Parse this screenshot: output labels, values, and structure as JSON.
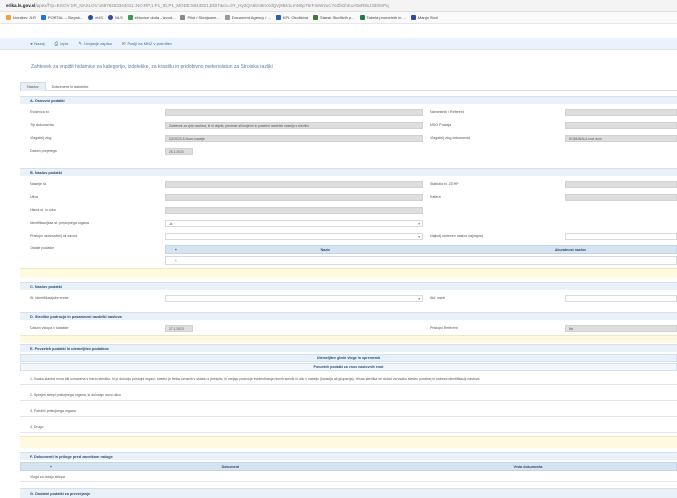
{
  "browser": {
    "url_host": "erika.ls.gov.sl",
    "url_path": "/apex/f?p=EGOV:SR_NASLOV:15879263344011::NO:RP,1:P1_ID,P1_MODE:5843921,EDIT&cs=3Y_Hy2QAtEm8mXdQVj9Bk1LmN0pT6rF4sW2uC7eZbGhKoA5vR8xJ3iD9nPq"
  },
  "bookmarks": [
    {
      "label": "Izvrsitev JLR",
      "color": "#f2a23a"
    },
    {
      "label": "PORTAL – Slepsk...",
      "color": "#1a73e8"
    },
    {
      "label": "eUS",
      "color": "#2a4f9e"
    },
    {
      "label": "NLS",
      "color": "#2a4f9e"
    },
    {
      "label": "eNovice doda - izvod...",
      "color": "#3c9d4a"
    },
    {
      "label": "Pilot / Skrajsane...",
      "color": "#888888"
    },
    {
      "label": "Document Agency / ...",
      "color": "#999999"
    },
    {
      "label": "KPL Okolistna",
      "color": "#2b5fb3"
    },
    {
      "label": "Starsk Storlitvih p...",
      "color": "#3a7d32"
    },
    {
      "label": "Tabela prometnih in ...",
      "color": "#1e7f4a"
    },
    {
      "label": "Manja Stori",
      "color": "#2a4f9e"
    }
  ],
  "toolbar": {
    "buttons": [
      {
        "icon": "◂",
        "label": "Nazaj"
      },
      {
        "icon": "⎙",
        "label": "Izpis"
      },
      {
        "icon": "✎",
        "label": "Urejanje zapisa"
      },
      {
        "icon": "✉",
        "label": "Poslji na MNZ v potrditev"
      }
    ]
  },
  "page": {
    "title": "Zahtevek za vnpiitit hidamice za kategorijo, izdelekke, za krastilu in pridobivno meteriolatun za Stroiska razliki",
    "tabs": [
      "Naslov",
      "Dokument in datoteke"
    ]
  },
  "sections": {
    "osnovni": {
      "header": "A. Osnovni podatki",
      "labels": [
        "Evidenca st.",
        "Tip dokumenta",
        "Vlagatelj vlog",
        "Datum prejetega"
      ],
      "values": [
        "",
        "Zahtevek za vpis naslova, ki ni objekt, predmet ali krajevni in posebni razdelek naselja s stevilko",
        "DZ/2023-5-Novo naselje",
        "25.1.2023"
      ],
      "right_labels": [
        "Namestnik / Referent",
        "MSO Postaja",
        "Vlagatelj vlog dokumenta"
      ],
      "right_values": [
        "",
        "",
        "KOMUNALA novi dom"
      ]
    },
    "naslov": {
      "header": "B. Naslov podatki",
      "labels": [
        "Naselje st.",
        "Ulica",
        "Hisna st. in crka",
        "Identifikacijska st. pristojnega organa",
        "Pristojni ustanovitelj ali zavod"
      ],
      "field_values": [
        "",
        "",
        "",
        "",
        "",
        ""
      ],
      "yes_value": "Ja",
      "other_label": "Ostale podatke",
      "no_value": "Ne",
      "right_labels": [
        "Statistia st. ZGHP",
        "Katera",
        "Najbolj ustrezen naslov najnaprej"
      ],
      "right_values": [
        "",
        "",
        ""
      ],
      "subtable_cols": [
        "Naziv",
        "Akuratnost naslov"
      ]
    },
    "naslov2": {
      "header": "C. Naslov podatki",
      "label": "St. identifikacijske enote",
      "right_label": "Akt. oseb",
      "value": "",
      "right_value": ""
    },
    "stevilke": {
      "header": "D. Stevilke podrocja in posamezni razdelki naslova",
      "label": "Datum vstopa v kataster",
      "value": "27.1.2023",
      "right_label": "Pristojni Referent",
      "right_value": "Ne"
    },
    "povzetek": {
      "header": "E. Povzetek podatki in utemeljitev podatkov",
      "band1": "Utemeljitev glede vloge in sprememb",
      "band2": "Povzetek podatki za vnos naslovnih enot",
      "rows": [
        "1. Vsaka stavba mora biti oznacena s hisno stevilko, ki jo dolocijo pristojni organi; stavbo je treba oznaciti v skladu s predpisi, ki urejajo podrocje evidentiranja hisnih stevilk in ulic v naselju (lokacija ali grupacija). Hisna stevilka se doloci za vsako stavbo posebej in ustreza identifikaciji naslova",
        "2. Sprejeti sklepi pristojnega organa, ki dolocajo novo ulico",
        "3. Potrdilo pristojnega organa",
        "4. Drugo"
      ]
    },
    "priloge": {
      "header": "F. Dokumenti in priloge pred zacetkom naloge",
      "cols": [
        "Dokument",
        "Vrsta dokumenta"
      ],
      "row": "Vloga za izdajo sklepa"
    },
    "dodatni": {
      "header": "G. Dodatni podatki za preverjanje"
    }
  }
}
